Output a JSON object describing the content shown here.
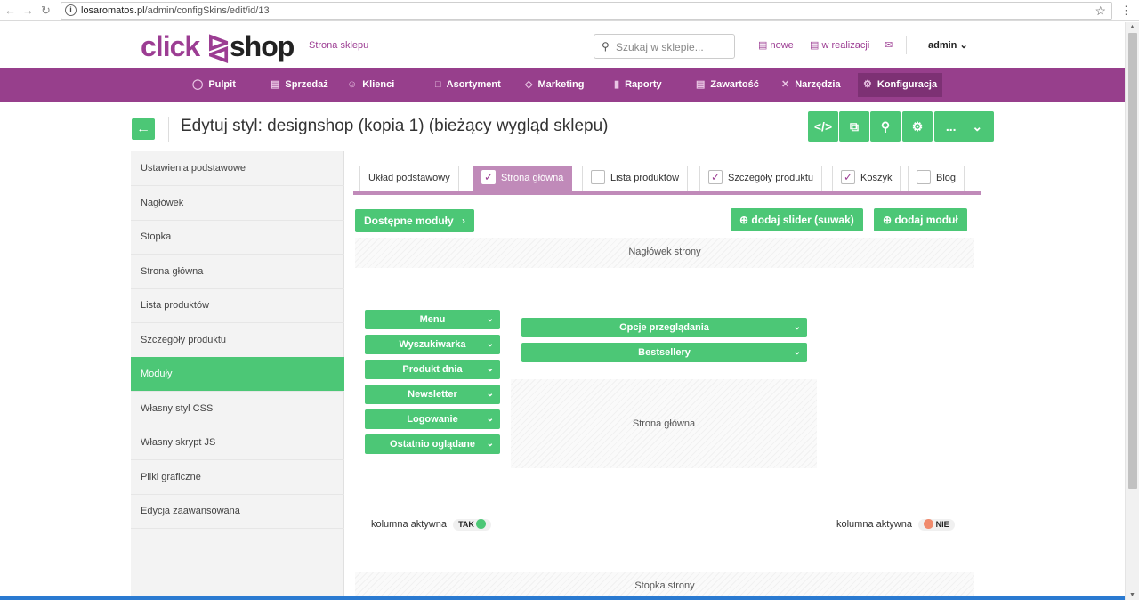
{
  "browser": {
    "url_host": "losaromatos.pl",
    "url_path": "/admin/configSkins/edit/id/13"
  },
  "header": {
    "logo_part1": "click",
    "logo_part2": "shop",
    "store_link": "Strona sklepu",
    "search_placeholder": "Szukaj w sklepie...",
    "orders_new": "nowe",
    "orders_in_progress": "w realizacji",
    "user": "admin"
  },
  "nav": {
    "items": [
      {
        "label": "Pulpit",
        "icon": "dashboard-icon"
      },
      {
        "label": "Sprzedaż",
        "icon": "basket-icon"
      },
      {
        "label": "Klienci",
        "icon": "users-icon"
      },
      {
        "label": "Asortyment",
        "icon": "box-icon"
      },
      {
        "label": "Marketing",
        "icon": "tag-icon"
      },
      {
        "label": "Raporty",
        "icon": "bar-chart-icon"
      },
      {
        "label": "Zawartość",
        "icon": "document-icon"
      },
      {
        "label": "Narzędzia",
        "icon": "tools-icon"
      },
      {
        "label": "Konfiguracja",
        "icon": "gear-icon"
      }
    ]
  },
  "page": {
    "title": "Edytuj styl: designshop (kopia 1) (bieżący wygląd sklepu)",
    "more_label": "..."
  },
  "sidebar": {
    "items": [
      {
        "label": "Ustawienia podstawowe"
      },
      {
        "label": "Nagłówek"
      },
      {
        "label": "Stopka"
      },
      {
        "label": "Strona główna"
      },
      {
        "label": "Lista produktów"
      },
      {
        "label": "Szczegóły produktu"
      },
      {
        "label": "Moduły"
      },
      {
        "label": "Własny styl CSS"
      },
      {
        "label": "Własny skrypt JS"
      },
      {
        "label": "Pliki graficzne"
      },
      {
        "label": "Edycja zaawansowana"
      }
    ]
  },
  "tabs": [
    {
      "label": "Układ podstawowy",
      "checked": null
    },
    {
      "label": "Strona główna",
      "checked": true
    },
    {
      "label": "Lista produktów",
      "checked": false
    },
    {
      "label": "Szczegóły produktu",
      "checked": true
    },
    {
      "label": "Koszyk",
      "checked": true
    },
    {
      "label": "Blog",
      "checked": false
    }
  ],
  "editor": {
    "available_modules": "Dostępne moduły",
    "add_slider": "dodaj slider (suwak)",
    "add_module": "dodaj moduł",
    "header_zone": "Nagłówek strony",
    "main_zone": "Strona główna",
    "footer_zone": "Stopka strony",
    "left_modules": [
      "Menu",
      "Wyszukiwarka",
      "Produkt dnia",
      "Newsletter",
      "Logowanie",
      "Ostatnio oglądane"
    ],
    "center_modules": [
      "Opcje przeglądania",
      "Bestsellery"
    ],
    "left_column_label": "kolumna aktywna",
    "left_column_state": "TAK",
    "right_column_label": "kolumna aktywna",
    "right_column_state": "NIE"
  },
  "colors": {
    "brand_purple": "#973f8c",
    "accent_green": "#4cc776",
    "inactive_orange": "#f08a6c"
  }
}
